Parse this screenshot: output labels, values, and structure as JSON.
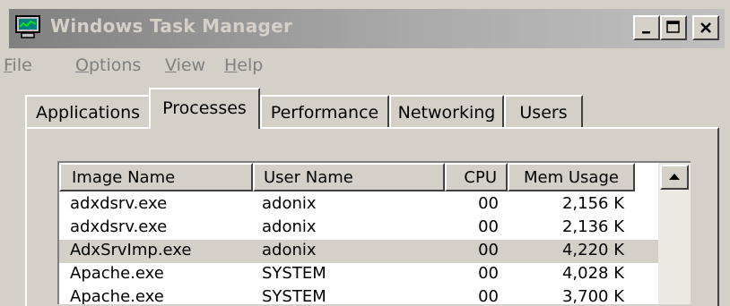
{
  "window": {
    "title": "Windows Task Manager"
  },
  "menu": [
    {
      "label": "File",
      "accel": "F",
      "rest": "ile"
    },
    {
      "label": "Options",
      "accel": "O",
      "rest": "ptions"
    },
    {
      "label": "View",
      "accel": "V",
      "rest": "iew"
    },
    {
      "label": "Help",
      "accel": "H",
      "rest": "elp"
    }
  ],
  "tabs": [
    {
      "label": "Applications",
      "active": false
    },
    {
      "label": "Processes",
      "active": true
    },
    {
      "label": "Performance",
      "active": false
    },
    {
      "label": "Networking",
      "active": false
    },
    {
      "label": "Users",
      "active": false
    }
  ],
  "process_list": {
    "columns": [
      "Image Name",
      "User Name",
      "CPU",
      "Mem Usage"
    ],
    "rows": [
      {
        "image": "adxdsrv.exe",
        "user": "adonix",
        "cpu": "00",
        "mem": "2,156 K",
        "selected": false
      },
      {
        "image": "adxdsrv.exe",
        "user": "adonix",
        "cpu": "00",
        "mem": "2,136 K",
        "selected": false
      },
      {
        "image": "AdxSrvImp.exe",
        "user": "adonix",
        "cpu": "00",
        "mem": "4,220 K",
        "selected": true
      },
      {
        "image": "Apache.exe",
        "user": "SYSTEM",
        "cpu": "00",
        "mem": "4,028 K",
        "selected": false
      },
      {
        "image": "Apache.exe",
        "user": "SYSTEM",
        "cpu": "00",
        "mem": "3,700 K",
        "selected": false
      }
    ]
  },
  "colors": {
    "face": "#d4d0c8",
    "title_gradient_start": "#808080",
    "title_text": "#d4d0c8",
    "list_bg": "#ffffff"
  },
  "icons": [
    "task-manager-icon",
    "minimize-icon",
    "maximize-icon",
    "close-icon",
    "scroll-up-arrow-icon"
  ]
}
